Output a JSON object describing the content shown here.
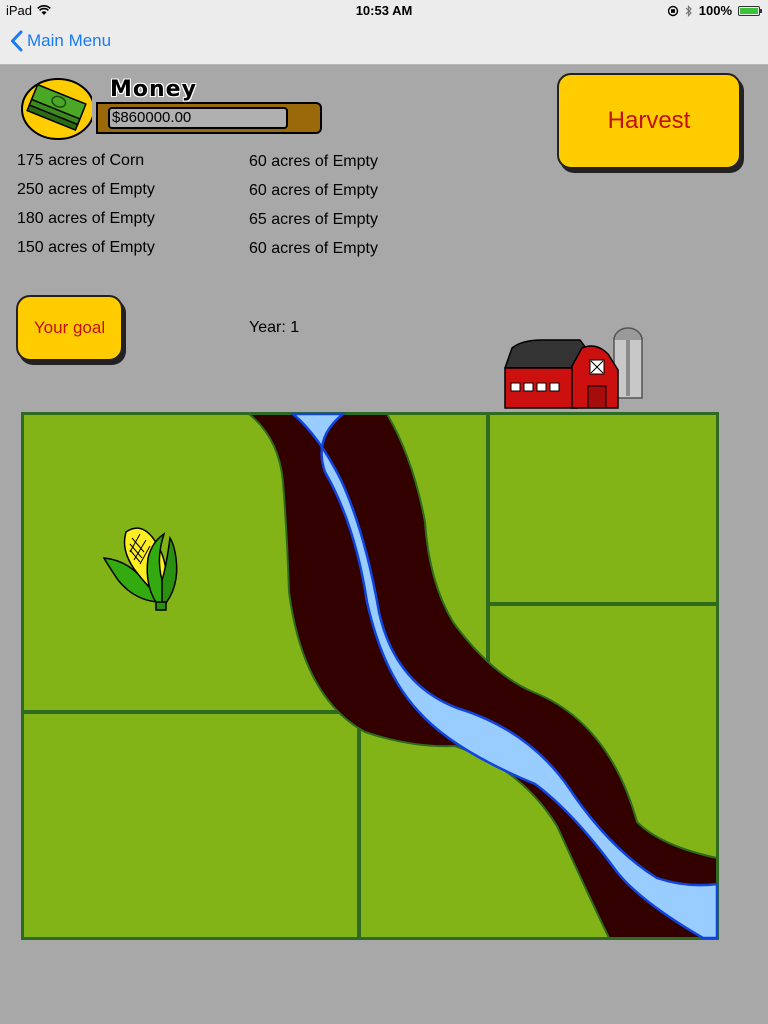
{
  "status_bar": {
    "device": "iPad",
    "time": "10:53 AM",
    "battery": "100%"
  },
  "nav": {
    "back_label": "Main Menu"
  },
  "money": {
    "label": "Money",
    "amount": "$860000.00"
  },
  "fields_left": [
    "175 acres of Corn",
    "250 acres of Empty",
    "180 acres of Empty",
    "150 acres of Empty"
  ],
  "fields_right": [
    "60 acres of Empty",
    "60 acres of Empty",
    "65 acres of Empty",
    "60 acres of Empty"
  ],
  "buttons": {
    "harvest": "Harvest",
    "goal": "Your goal"
  },
  "year": "Year: 1",
  "icons": {
    "money": "money-stack-icon",
    "barn": "barn-icon",
    "crop": "corn-icon",
    "back": "chevron-left-icon"
  },
  "colors": {
    "background": "#a8a8a8",
    "field_green": "#82b418",
    "river_blue": "#99ccff",
    "riverbank": "#330000",
    "button_yellow": "#ffcc00",
    "button_text": "#c01010",
    "ios_blue": "#1a7cf5"
  }
}
